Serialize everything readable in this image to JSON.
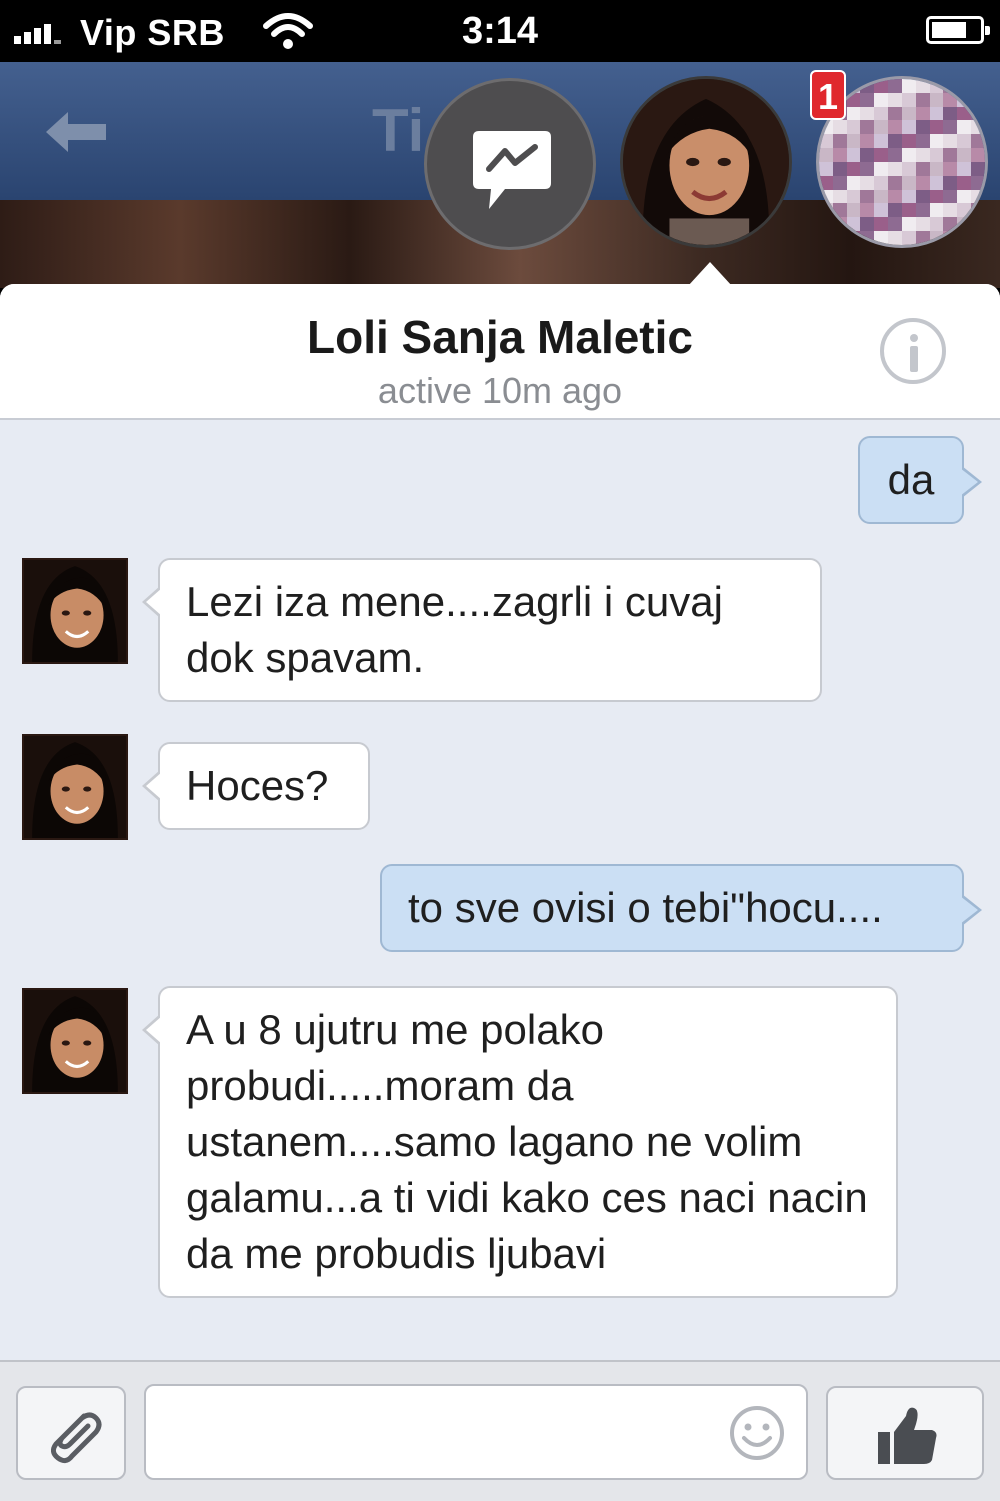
{
  "status_bar": {
    "carrier": "Vip SRB",
    "time": "3:14",
    "icons": [
      "signal-icon",
      "wifi-icon",
      "battery-icon"
    ]
  },
  "nav": {
    "title_visible": "Ti",
    "back_icon": "back-arrow-icon"
  },
  "chat_heads": {
    "messenger_icon": "messenger-icon",
    "notification_count": "1"
  },
  "conversation": {
    "contact_name": "Loli Sanja Maletic",
    "status": "active 10m ago",
    "info_icon": "info-icon"
  },
  "messages": [
    {
      "direction": "outgoing",
      "text": "da"
    },
    {
      "direction": "incoming",
      "text": "Lezi iza mene....zagrli i cuvaj dok spavam."
    },
    {
      "direction": "incoming",
      "text": "Hoces?"
    },
    {
      "direction": "outgoing",
      "text": "to sve ovisi o tebi\"hocu...."
    },
    {
      "direction": "incoming",
      "text": "A u 8 ujutru me polako probudi.....moram da ustanem....samo lagano ne volim galamu...a ti vidi kako ces naci nacin da me probudis ljubavi"
    }
  ],
  "composer": {
    "input_value": "",
    "icons": [
      "paperclip-icon",
      "smiley-icon",
      "thumbs-up-icon"
    ]
  },
  "colors": {
    "header_blue": "#2a4470",
    "incoming_bubble": "#ffffff",
    "outgoing_bubble": "#cbdff4",
    "panel_bg": "#e7ebf3",
    "badge_red": "#e0282d"
  }
}
